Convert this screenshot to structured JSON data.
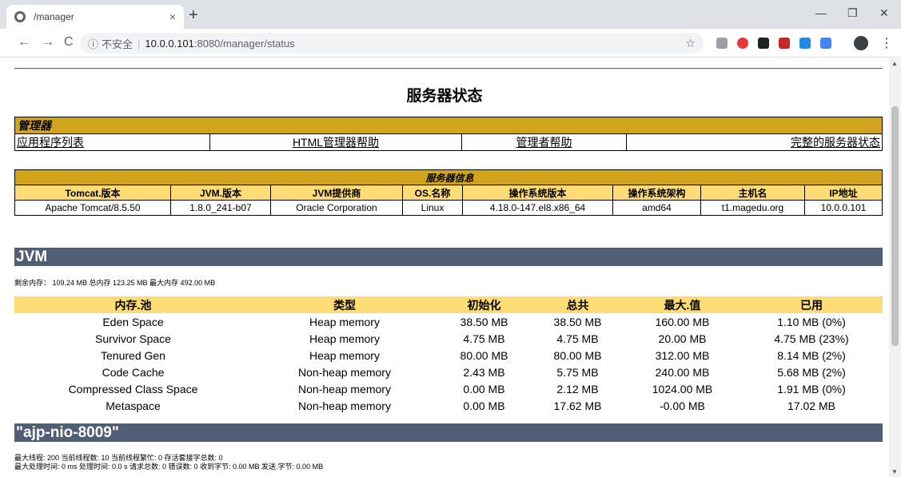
{
  "browser": {
    "tab_title": "/manager",
    "tab_close": "×",
    "new_tab": "+",
    "minimize": "—",
    "restore": "❐",
    "close": "✕",
    "back": "←",
    "forward": "→",
    "reload": "C",
    "insecure_label": "不安全",
    "url_host": "10.0.0.101",
    "url_path": ":8080/manager/status",
    "star": "☆",
    "menu": "⋮"
  },
  "page": {
    "title": "服务器状态",
    "manager": {
      "header": "管理器",
      "links": [
        "应用程序列表",
        "HTML管理器帮助",
        "管理者帮助",
        "完整的服务器状态"
      ]
    },
    "server_info": {
      "header": "服务器信息",
      "columns": [
        "Tomcat.版本",
        "JVM.版本",
        "JVM提供商",
        "OS.名称",
        "操作系统版本",
        "操作系统架构",
        "主机名",
        "IP地址"
      ],
      "values": [
        "Apache Tomcat/8.5.50",
        "1.8.0_241-b07",
        "Oracle Corporation",
        "Linux",
        "4.18.0-147.el8.x86_64",
        "amd64",
        "t1.magedu.org",
        "10.0.0.101"
      ]
    },
    "jvm": {
      "title": "JVM",
      "memory_summary": "剩余内存： 109.24 MB 总内存 123.25 MB 最大内存 492.00 MB",
      "columns": [
        "内存.池",
        "类型",
        "初始化",
        "总共",
        "最大.值",
        "已用"
      ],
      "rows": [
        [
          "Eden Space",
          "Heap memory",
          "38.50 MB",
          "38.50 MB",
          "160.00 MB",
          "1.10 MB (0%)"
        ],
        [
          "Survivor Space",
          "Heap memory",
          "4.75 MB",
          "4.75 MB",
          "20.00 MB",
          "4.75 MB (23%)"
        ],
        [
          "Tenured Gen",
          "Heap memory",
          "80.00 MB",
          "80.00 MB",
          "312.00 MB",
          "8.14 MB (2%)"
        ],
        [
          "Code Cache",
          "Non-heap memory",
          "2.43 MB",
          "5.75 MB",
          "240.00 MB",
          "5.68 MB (2%)"
        ],
        [
          "Compressed Class Space",
          "Non-heap memory",
          "0.00 MB",
          "2.12 MB",
          "1024.00 MB",
          "1.91 MB (0%)"
        ],
        [
          "Metaspace",
          "Non-heap memory",
          "0.00 MB",
          "17.62 MB",
          "-0.00 MB",
          "17.02 MB"
        ]
      ]
    },
    "connector": {
      "title": "\"ajp-nio-8009\"",
      "line1": "最大线程:  200 当前线程数:  10 当前线程繁忙:  0 存活套接字总数:  0",
      "line2": "最大处理时间:  0 ms 处理时间:  0.0 s 请求总数:  0 错误数:  0 收到字节:  0.00 MB 发送.字节: 0.00 MB"
    }
  },
  "colors": {
    "header_gold": "#d2a41c",
    "column_yellow": "#ffdc75",
    "section_slate": "#525d76"
  }
}
